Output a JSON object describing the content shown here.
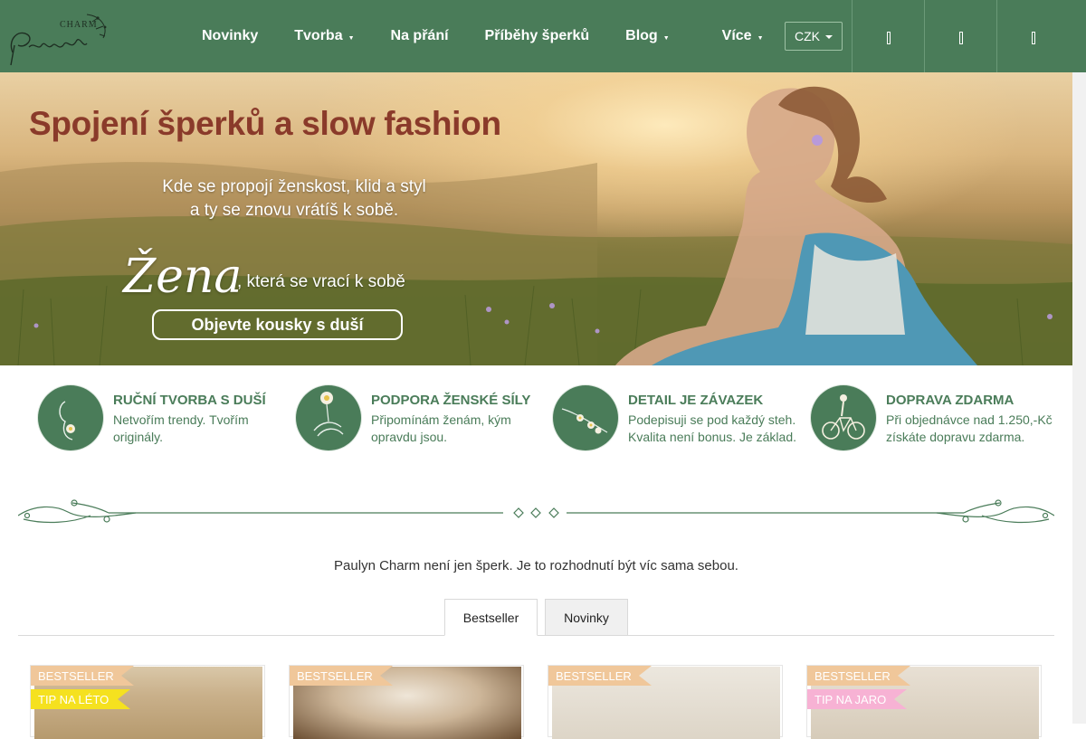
{
  "brand": {
    "name": "Paulyn",
    "sub": "CHARM",
    "color": "#4a7c59"
  },
  "nav": {
    "items": [
      {
        "label": "Novinky",
        "has_dropdown": false
      },
      {
        "label": "Tvorba",
        "has_dropdown": true
      },
      {
        "label": "Na přání",
        "has_dropdown": false
      },
      {
        "label": "Příběhy šperků",
        "has_dropdown": false
      },
      {
        "label": "Blog",
        "has_dropdown": true
      },
      {
        "label": "Více",
        "has_dropdown": true
      }
    ],
    "currency": "CZK",
    "icons": [
      "search-icon",
      "user-icon",
      "cart-icon"
    ]
  },
  "hero": {
    "title": "Spojení šperků a slow fashion",
    "subtitle_line1": "Kde se propojí ženskost, klid a styl",
    "subtitle_line2": "a ty se znovu vrátíš k sobě.",
    "script_word": "Žena",
    "script_tail": ", která se vrací k sobě",
    "cta": "Objevte kousky s duší"
  },
  "features": [
    {
      "icon": "woman-flower-icon",
      "title": "RUČNÍ TVORBA S DUŠÍ",
      "text": "Netvořím trendy. Tvořím originály."
    },
    {
      "icon": "hands-daisy-icon",
      "title": "PODPORA ŽENSKÉ SÍLY",
      "text": "Připomínám ženám, kým opravdu jsou."
    },
    {
      "icon": "flower-chain-icon",
      "title": "DETAIL JE ZÁVAZEK",
      "text": "Podepisuji se pod každý steh. Kvalita není bonus. Je základ."
    },
    {
      "icon": "bicycle-icon",
      "title": "DOPRAVA ZDARMA",
      "text": "Při objednávce nad 1.250,-Kč získáte dopravu zdarma."
    }
  ],
  "tagline": "Paulyn Charm není jen šperk. Je to rozhodnutí být víc sama sebou.",
  "tabs": [
    {
      "label": "Bestseller",
      "active": true
    },
    {
      "label": "Novinky",
      "active": false
    }
  ],
  "products": [
    {
      "flags": [
        "BESTSELLER",
        "TIP NA LÉTO"
      ]
    },
    {
      "flags": [
        "BESTSELLER"
      ]
    },
    {
      "flags": [
        "BESTSELLER"
      ]
    },
    {
      "flags": [
        "BESTSELLER",
        "TIP NA JARO"
      ]
    }
  ]
}
